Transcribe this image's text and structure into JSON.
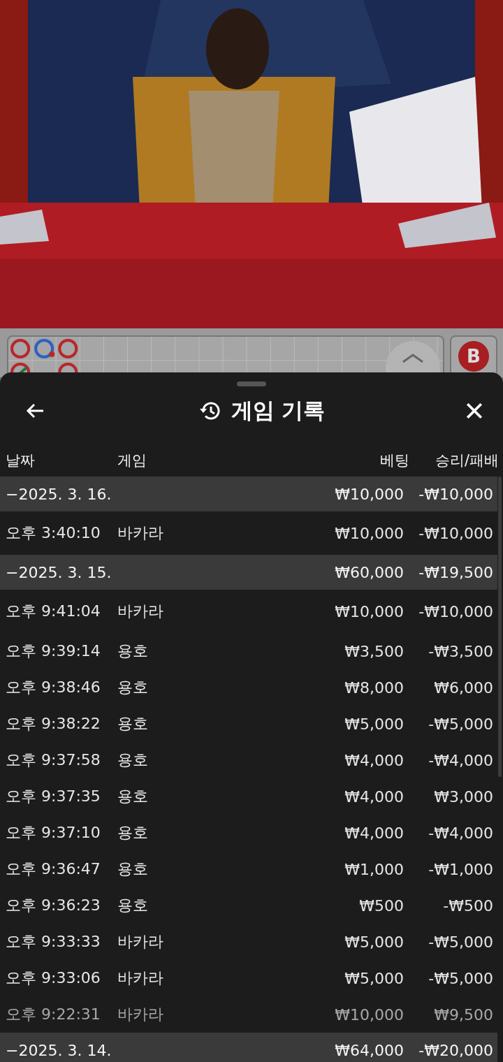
{
  "roadmap": {
    "badge": "B"
  },
  "sheet": {
    "title": "게임 기록",
    "columns": [
      "날짜",
      "게임",
      "베팅",
      "승리/패배"
    ],
    "groups": [
      {
        "date": "−2025. 3. 16.",
        "bet": "₩10,000",
        "result": "-₩10,000",
        "items": [
          {
            "time": "오후 3:40:10",
            "game": "바카라",
            "bet": "₩10,000",
            "result": "-₩10,000"
          }
        ]
      },
      {
        "date": "−2025. 3. 15.",
        "bet": "₩60,000",
        "result": "-₩19,500",
        "items": [
          {
            "time": "오후 9:41:04",
            "game": "바카라",
            "bet": "₩10,000",
            "result": "-₩10,000"
          },
          {
            "time": "오후 9:39:14",
            "game": "용호",
            "bet": "₩3,500",
            "result": "-₩3,500"
          },
          {
            "time": "오후 9:38:46",
            "game": "용호",
            "bet": "₩8,000",
            "result": "₩6,000"
          },
          {
            "time": "오후 9:38:22",
            "game": "용호",
            "bet": "₩5,000",
            "result": "-₩5,000"
          },
          {
            "time": "오후 9:37:58",
            "game": "용호",
            "bet": "₩4,000",
            "result": "-₩4,000"
          },
          {
            "time": "오후 9:37:35",
            "game": "용호",
            "bet": "₩4,000",
            "result": "₩3,000"
          },
          {
            "time": "오후 9:37:10",
            "game": "용호",
            "bet": "₩4,000",
            "result": "-₩4,000"
          },
          {
            "time": "오후 9:36:47",
            "game": "용호",
            "bet": "₩1,000",
            "result": "-₩1,000"
          },
          {
            "time": "오후 9:36:23",
            "game": "용호",
            "bet": "₩500",
            "result": "-₩500"
          },
          {
            "time": "오후 9:33:33",
            "game": "바카라",
            "bet": "₩5,000",
            "result": "-₩5,000"
          },
          {
            "time": "오후 9:33:06",
            "game": "바카라",
            "bet": "₩5,000",
            "result": "-₩5,000"
          },
          {
            "time": "오후 9:22:31",
            "game": "바카라",
            "bet": "₩10,000",
            "result": "₩9,500"
          }
        ]
      },
      {
        "date": "−2025. 3. 14.",
        "bet": "₩64,000",
        "result": "-₩20,000"
      }
    ]
  }
}
